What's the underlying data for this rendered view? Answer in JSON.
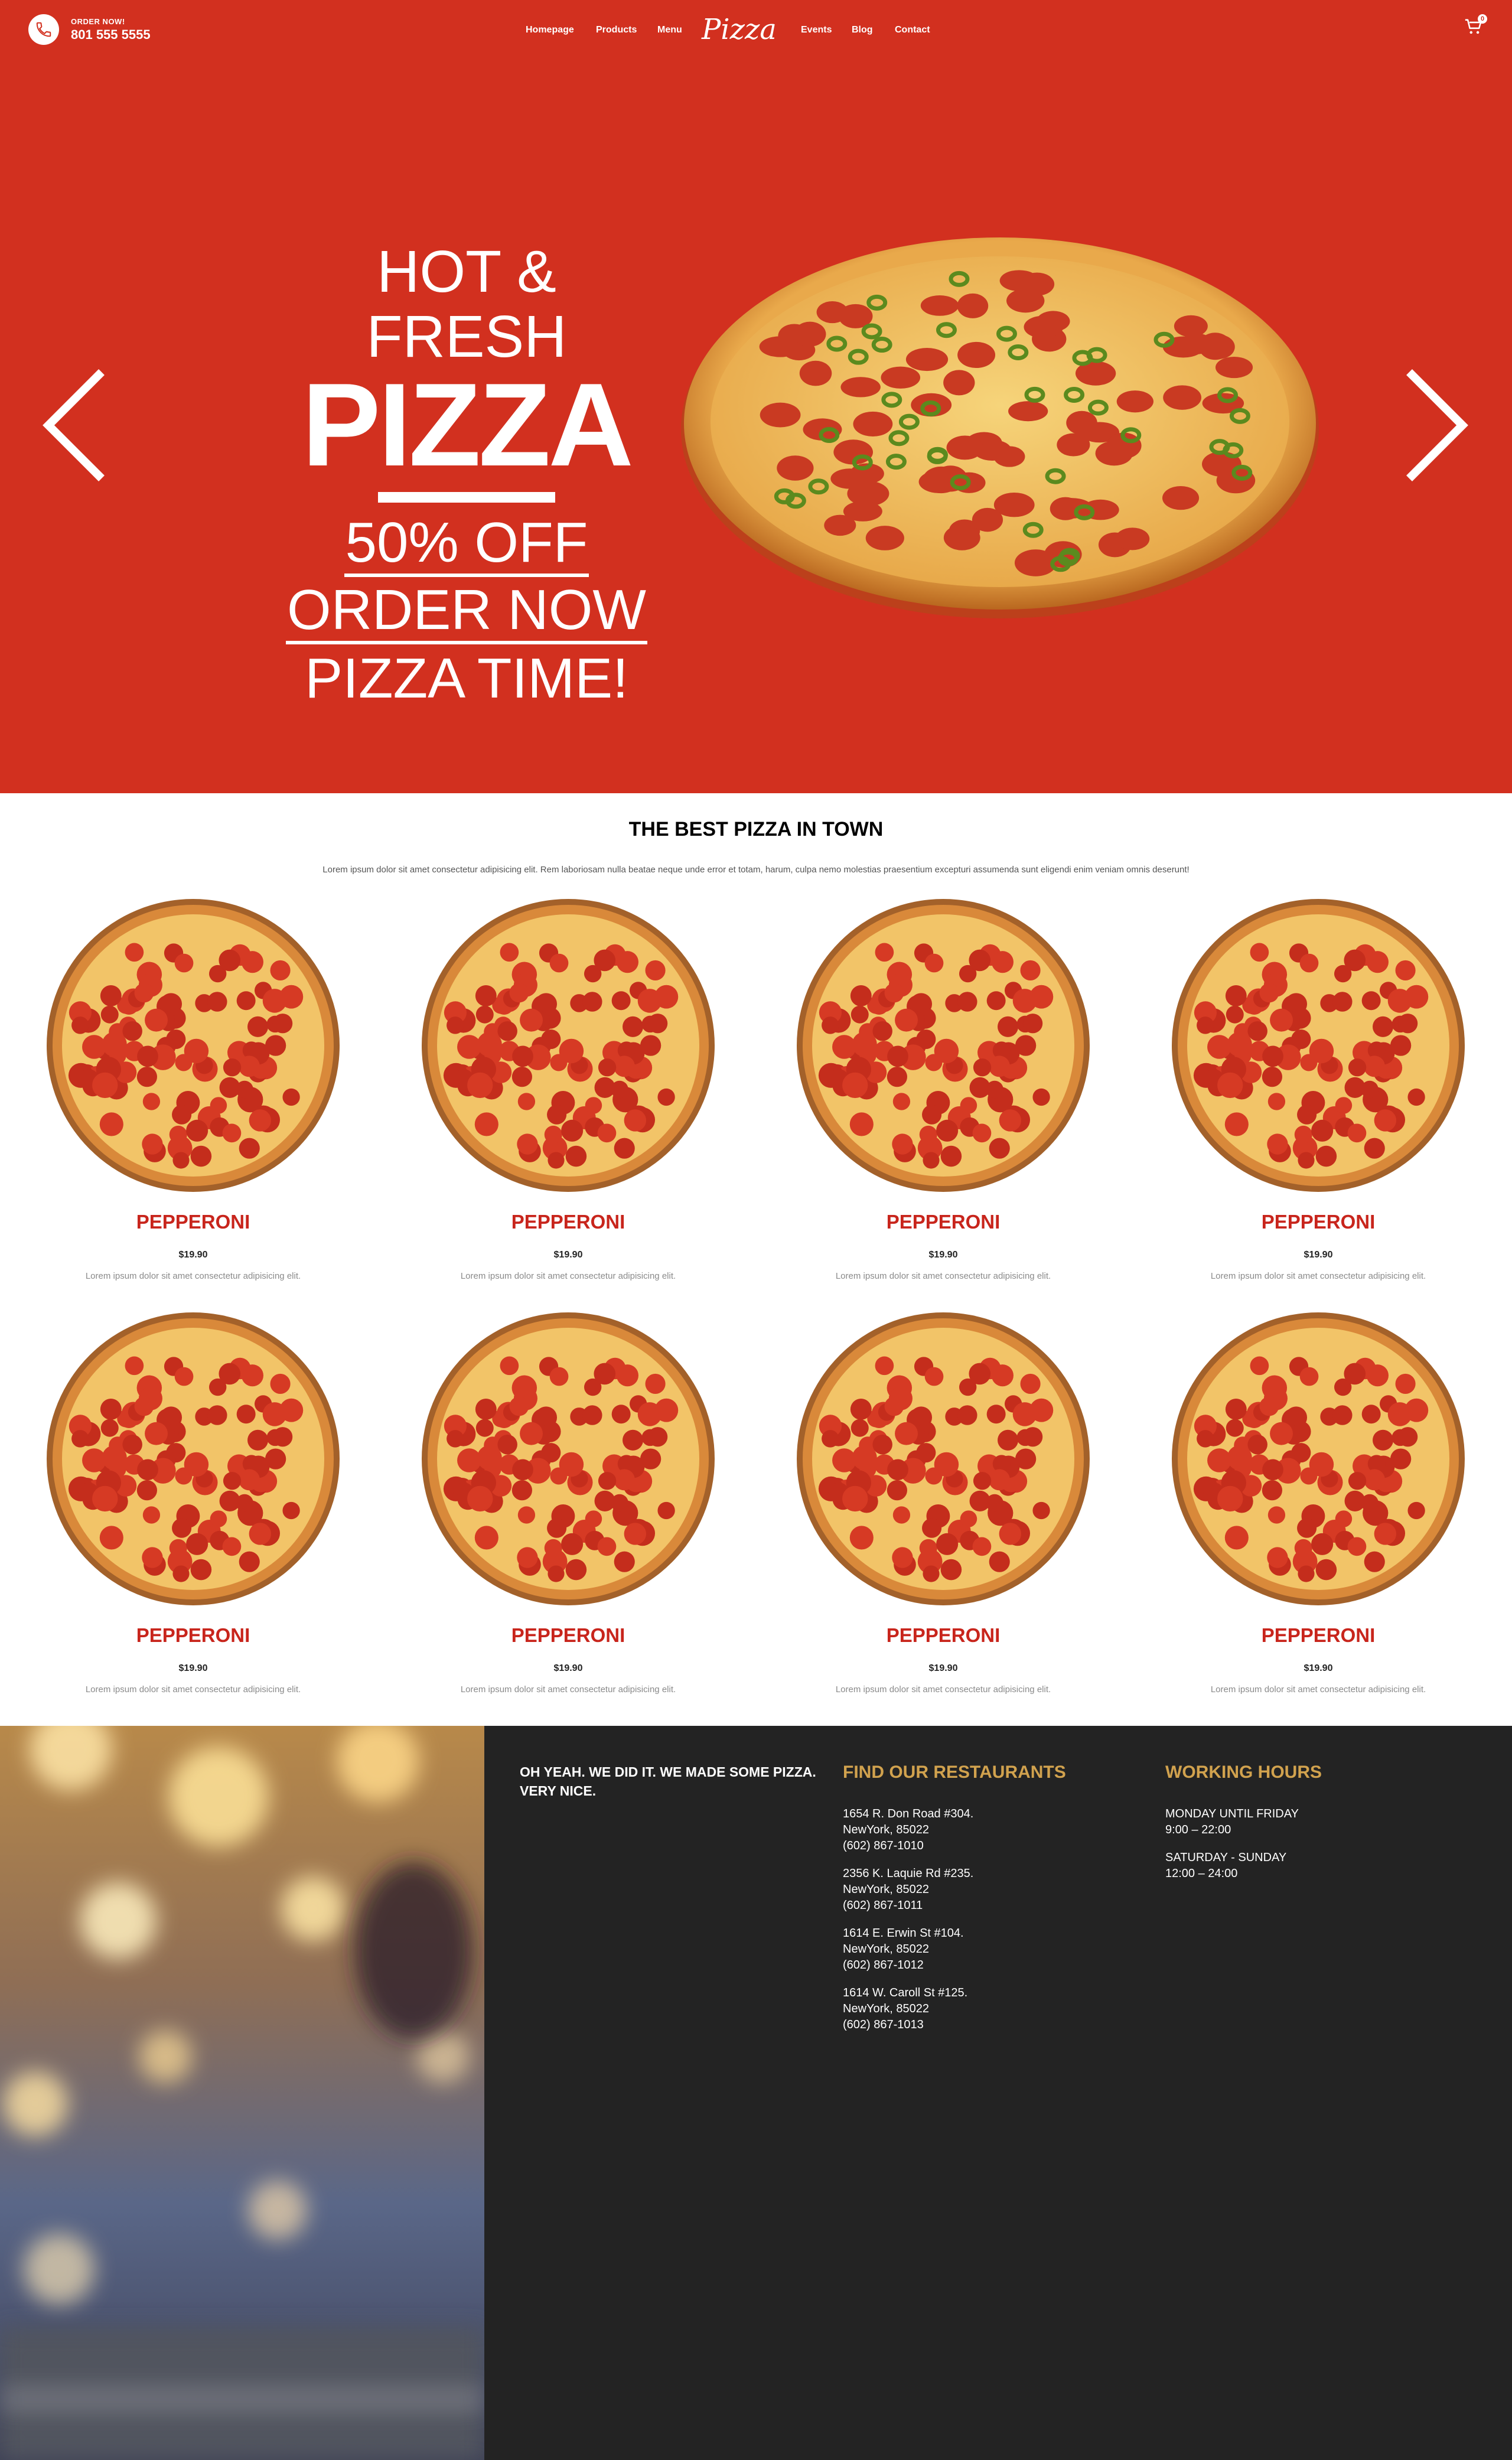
{
  "header": {
    "order_label": "ORDER NOW!",
    "phone": "801 555 5555",
    "nav": [
      "Homepage",
      "Products",
      "Menu",
      "Events",
      "Blog",
      "Contact"
    ],
    "logo": "Pizza",
    "cart_count": "0"
  },
  "hero": {
    "line1": "HOT & FRESH",
    "line2": "PIZZA",
    "line3": "50% OFF",
    "line4": "ORDER NOW",
    "line5": "PIZZA TIME!"
  },
  "menu": {
    "title": "THE BEST PIZZA IN TOWN",
    "subtitle": "Lorem ipsum dolor sit amet consectetur adipisicing elit. Rem laboriosam nulla beatae neque unde error et totam, harum, culpa nemo molestias praesentium excepturi assumenda sunt eligendi enim veniam omnis deserunt!",
    "products": [
      {
        "name": "PEPPERONI",
        "price": "$19.90",
        "desc": "Lorem ipsum dolor sit amet consectetur adipisicing elit."
      },
      {
        "name": "PEPPERONI",
        "price": "$19.90",
        "desc": "Lorem ipsum dolor sit amet consectetur adipisicing elit."
      },
      {
        "name": "PEPPERONI",
        "price": "$19.90",
        "desc": "Lorem ipsum dolor sit amet consectetur adipisicing elit."
      },
      {
        "name": "PEPPERONI",
        "price": "$19.90",
        "desc": "Lorem ipsum dolor sit amet consectetur adipisicing elit."
      },
      {
        "name": "PEPPERONI",
        "price": "$19.90",
        "desc": "Lorem ipsum dolor sit amet consectetur adipisicing elit."
      },
      {
        "name": "PEPPERONI",
        "price": "$19.90",
        "desc": "Lorem ipsum dolor sit amet consectetur adipisicing elit."
      },
      {
        "name": "PEPPERONI",
        "price": "$19.90",
        "desc": "Lorem ipsum dolor sit amet consectetur adipisicing elit."
      },
      {
        "name": "PEPPERONI",
        "price": "$19.90",
        "desc": "Lorem ipsum dolor sit amet consectetur adipisicing elit."
      }
    ]
  },
  "footer": {
    "tagline_1": "OH YEAH. WE DID IT. WE MADE SOME PIZZA.",
    "tagline_2": "VERY NICE.",
    "restaurants_title": "FIND OUR RESTAURANTS",
    "restaurants": [
      {
        "street": "1654 R. Don Road #304.",
        "city": "NewYork, 85022",
        "phone": "(602) 867-1010"
      },
      {
        "street": "2356 K. Laquie Rd #235.",
        "city": "NewYork, 85022",
        "phone": "(602) 867-1011"
      },
      {
        "street": "1614 E. Erwin St #104.",
        "city": "NewYork, 85022",
        "phone": "(602) 867-1012"
      },
      {
        "street": "1614 W. Caroll St #125.",
        "city": "NewYork, 85022",
        "phone": "(602) 867-1013"
      }
    ],
    "hours_title": "WORKING HOURS",
    "hours": [
      {
        "days": "MONDAY UNTIL FRIDAY",
        "time": "9:00 – 22:00"
      },
      {
        "days": "SATURDAY - SUNDAY",
        "time": "12:00 – 24:00"
      }
    ]
  },
  "colors": {
    "brand_red": "#d2301f",
    "product_red": "#c8251c",
    "footer_dark": "#232323",
    "footer_gold": "#d1a24e"
  }
}
